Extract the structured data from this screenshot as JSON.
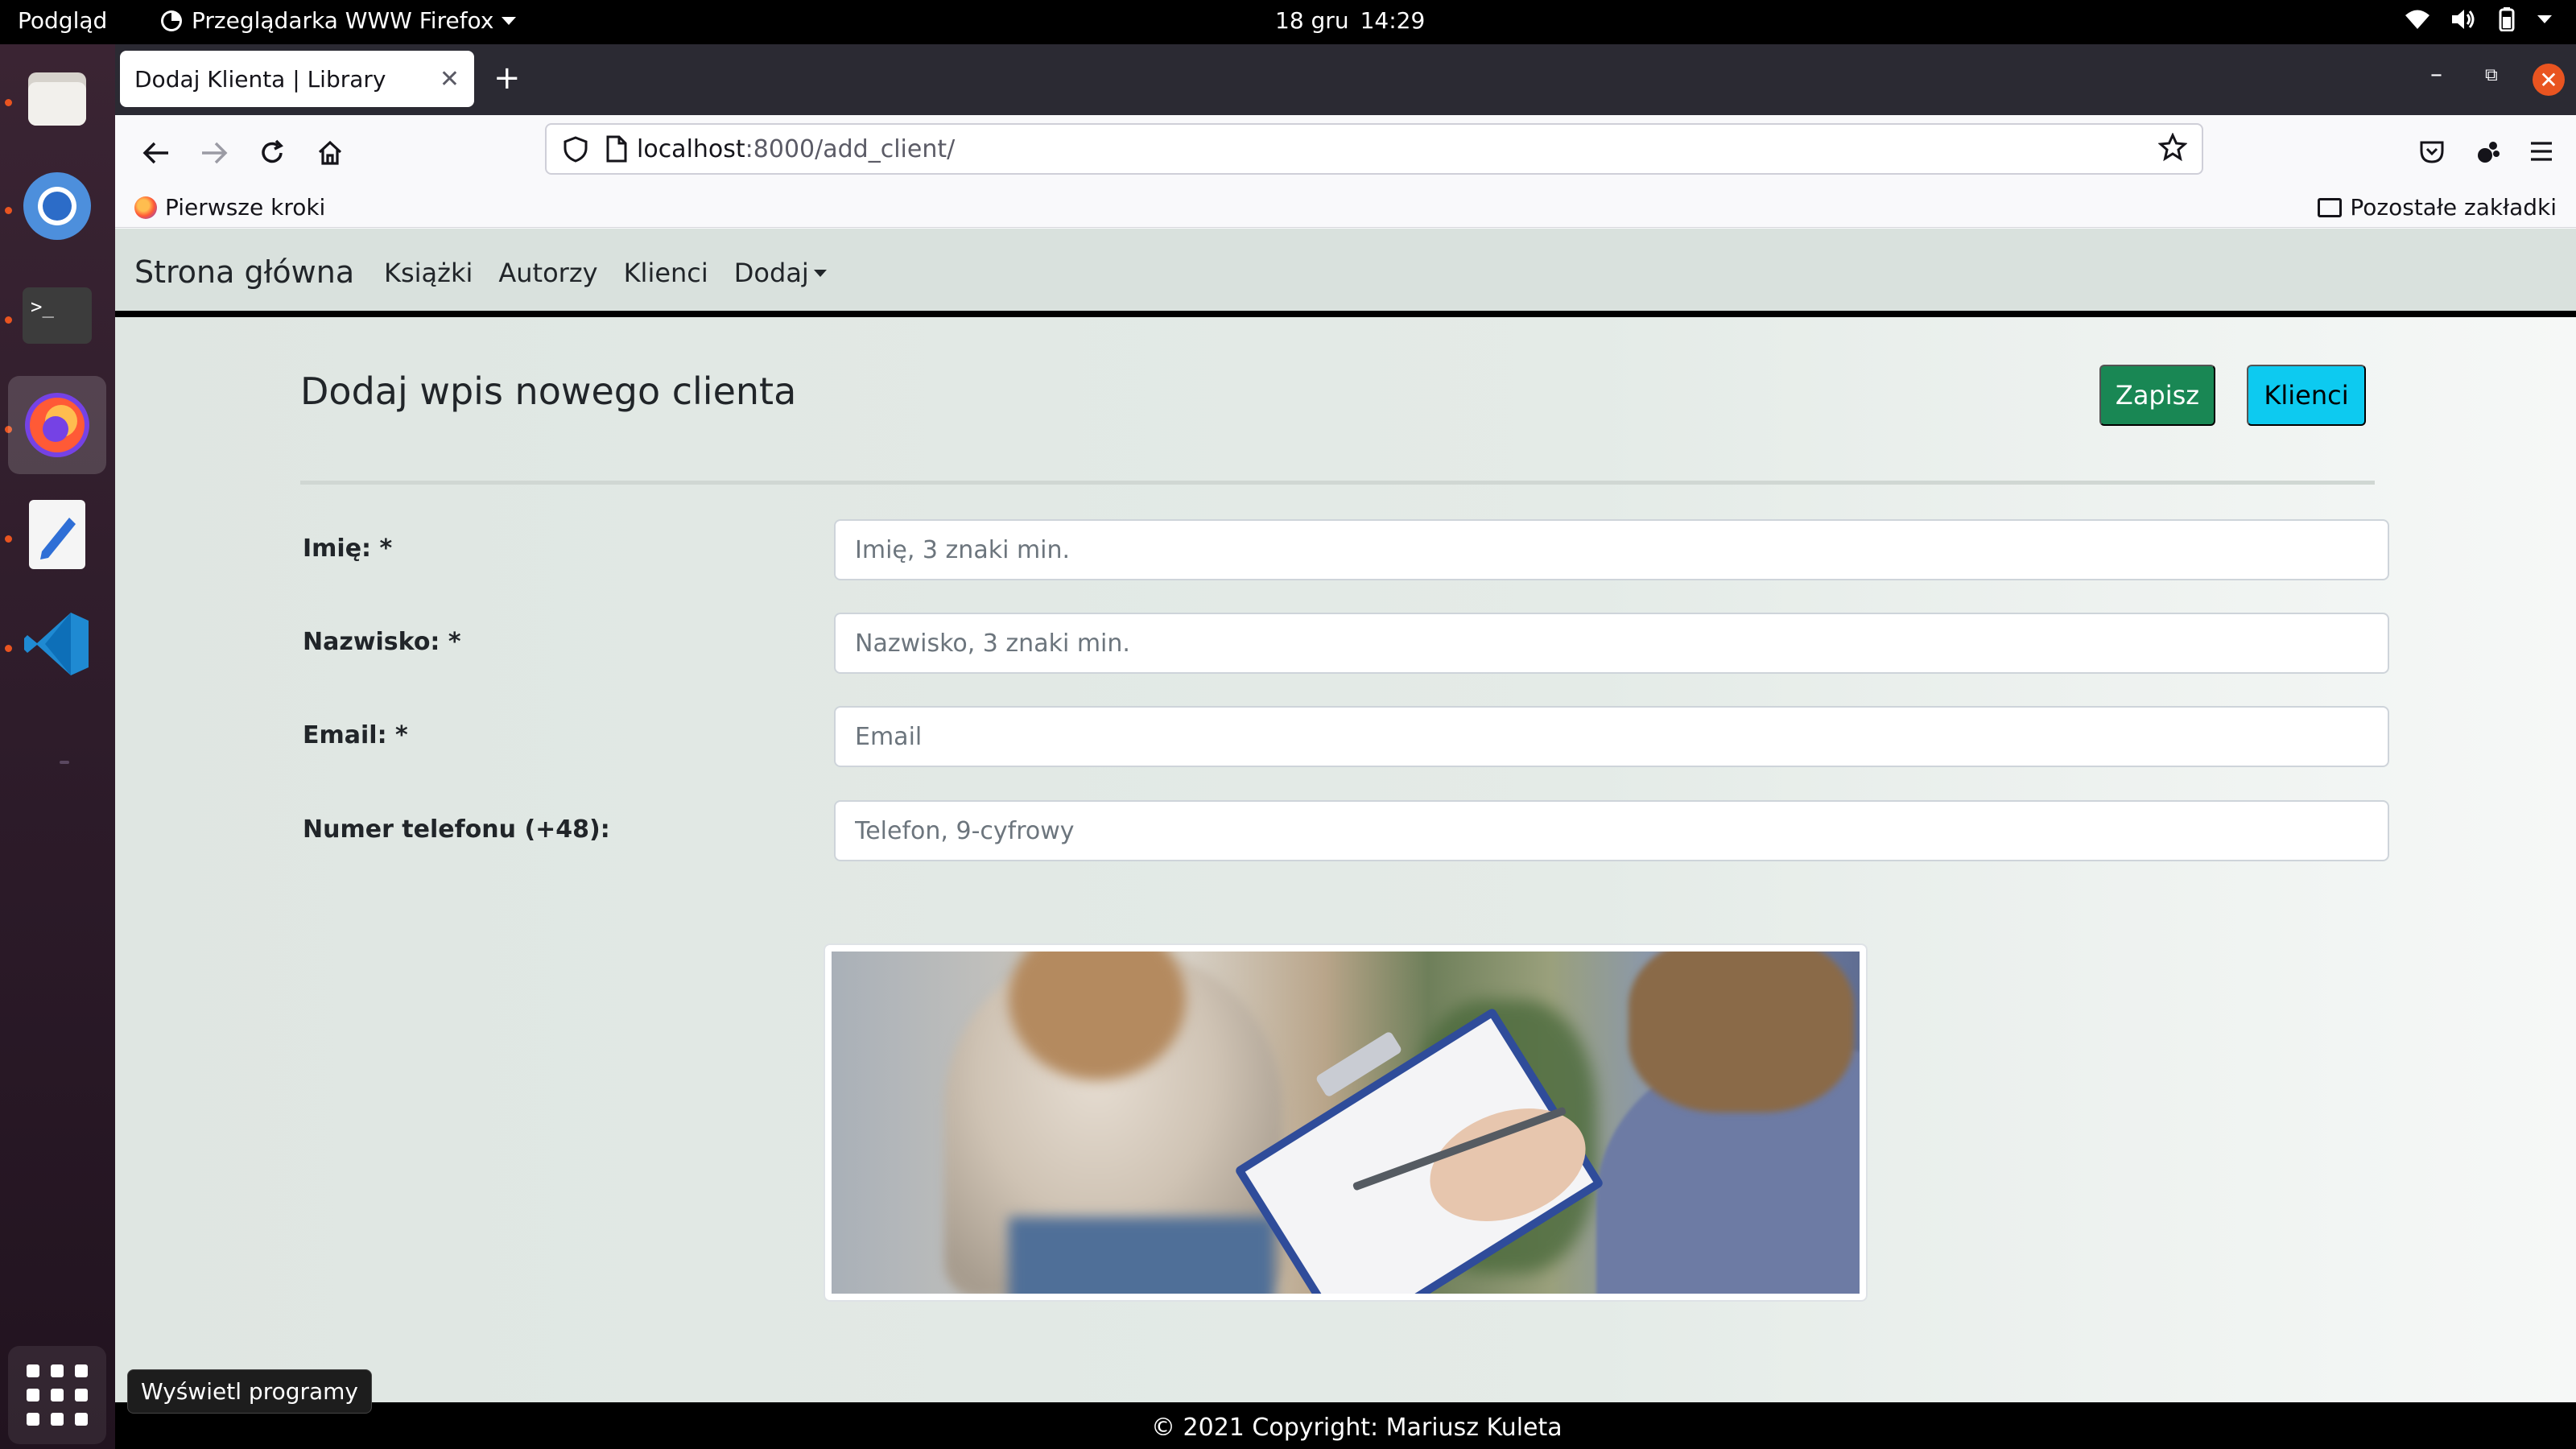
{
  "topbar": {
    "activities": "Podgląd",
    "app_name": "Przeglądarka WWW Firefox",
    "date": "18 gru",
    "time": "14:29"
  },
  "dock": {
    "items": [
      "files-icon",
      "chromium-icon",
      "terminal-icon",
      "firefox-icon",
      "text-editor-icon",
      "vscode-icon"
    ],
    "show_apps_tooltip": "Wyświetl programy"
  },
  "browser": {
    "tab_title": "Dodaj Klienta | Library",
    "url_host": "localhost",
    "url_path": ":8000/add_client/",
    "bookmark_first": "Pierwsze kroki",
    "bookmark_other": "Pozostałe zakładki"
  },
  "site": {
    "brand": "Strona główna",
    "nav": [
      "Książki",
      "Autorzy",
      "Klienci",
      "Dodaj"
    ]
  },
  "form": {
    "title": "Dodaj wpis nowego clienta",
    "save_label": "Zapisz",
    "clients_label": "Klienci",
    "fields": [
      {
        "label": "Imię: *",
        "placeholder": "Imię, 3 znaki min.",
        "value": ""
      },
      {
        "label": "Nazwisko: *",
        "placeholder": "Nazwisko, 3 znaki min.",
        "value": ""
      },
      {
        "label": "Email: *",
        "placeholder": "Email",
        "value": ""
      },
      {
        "label": "Numer telefonu (+48):",
        "placeholder": "Telefon, 9-cyfrowy",
        "value": ""
      }
    ]
  },
  "footer": {
    "text": "© 2021 Copyright: Mariusz Kuleta"
  },
  "colors": {
    "save_button": "#198754",
    "clients_button": "#0dcaf0",
    "ubuntu_accent": "#e95420"
  }
}
